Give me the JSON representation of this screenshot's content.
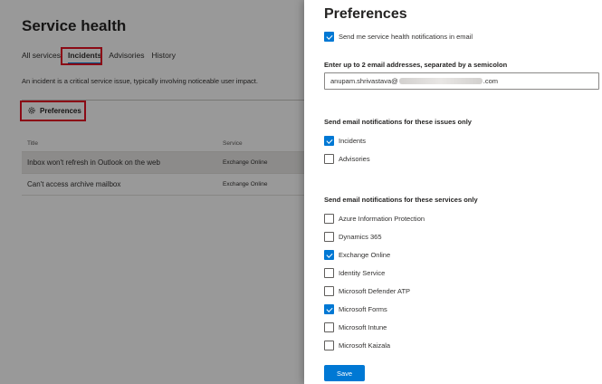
{
  "page": {
    "title": "Service health",
    "tabs": [
      "All services",
      "Incidents",
      "Advisories",
      "History"
    ],
    "description": "An incident is a critical service issue, typically involving noticeable user impact.",
    "preferences_label": "Preferences",
    "table": {
      "headers": [
        "Title",
        "Service"
      ],
      "rows": [
        {
          "title": "Inbox won't refresh in Outlook on the web",
          "service": "Exchange Online"
        },
        {
          "title": "Can't access archive mailbox",
          "service": "Exchange Online"
        }
      ]
    }
  },
  "panel": {
    "title": "Preferences",
    "notify_email_label": "Send me service health notifications in email",
    "email_label": "Enter up to 2 email addresses, separated by a semicolon",
    "email_prefix": "anupam.shrivastava@",
    "email_suffix": ".com",
    "issues_label": "Send email notifications for these issues only",
    "issues": [
      {
        "label": "Incidents",
        "checked": true
      },
      {
        "label": "Advisories",
        "checked": false
      }
    ],
    "services_label": "Send email notifications for these services only",
    "services": [
      {
        "label": "Azure Information Protection",
        "checked": false
      },
      {
        "label": "Dynamics 365",
        "checked": false
      },
      {
        "label": "Exchange Online",
        "checked": true
      },
      {
        "label": "Identity Service",
        "checked": false
      },
      {
        "label": "Microsoft Defender ATP",
        "checked": false
      },
      {
        "label": "Microsoft Forms",
        "checked": true
      },
      {
        "label": "Microsoft Intune",
        "checked": false
      },
      {
        "label": "Microsoft Kaizala",
        "checked": false
      }
    ],
    "save_label": "Save"
  },
  "colors": {
    "accent": "#0078d4",
    "highlight": "#e81123"
  }
}
